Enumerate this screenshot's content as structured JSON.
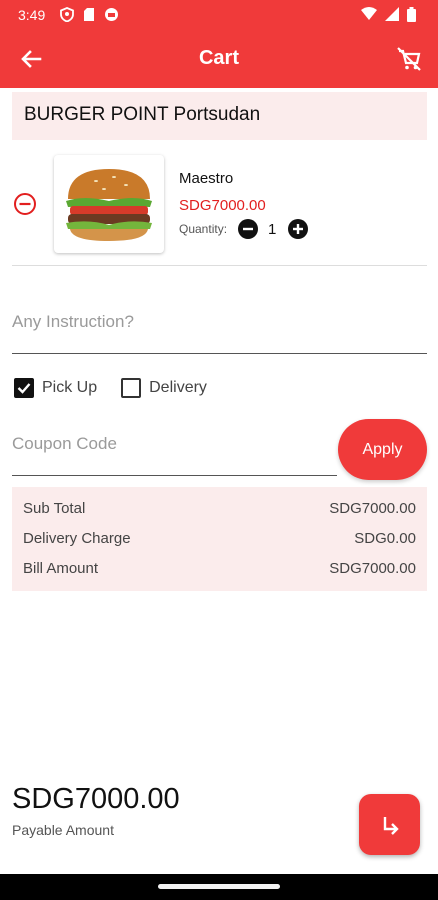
{
  "status_bar": {
    "time": "3:49"
  },
  "app_bar": {
    "title": "Cart"
  },
  "store": {
    "name": "BURGER POINT Portsudan"
  },
  "item": {
    "name": "Maestro",
    "price": "SDG7000.00",
    "quantity_label": "Quantity:",
    "quantity": "1"
  },
  "instruction": {
    "placeholder": "Any Instruction?"
  },
  "options": [
    {
      "label": "Pick Up",
      "checked": true
    },
    {
      "label": "Delivery",
      "checked": false
    }
  ],
  "coupon": {
    "placeholder": "Coupon Code",
    "apply_label": "Apply"
  },
  "summary": {
    "rows": [
      {
        "label": "Sub Total",
        "value": "SDG7000.00"
      },
      {
        "label": "Delivery Charge",
        "value": "SDG0.00"
      },
      {
        "label": "Bill Amount",
        "value": "SDG7000.00"
      }
    ]
  },
  "footer": {
    "amount": "SDG7000.00",
    "label": "Payable Amount"
  },
  "colors": {
    "accent": "#f03a3a",
    "price": "#e21f1f",
    "panel": "#fbecec"
  }
}
